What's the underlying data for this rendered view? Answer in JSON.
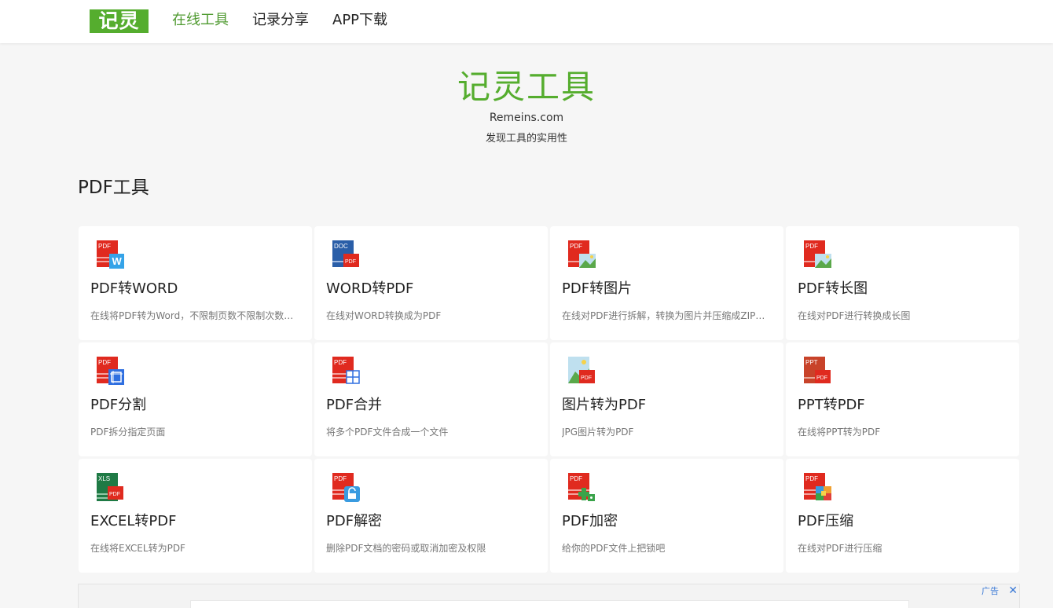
{
  "header": {
    "logo_text": "记灵",
    "nav": [
      {
        "label": "在线工具",
        "active": true
      },
      {
        "label": "记录分享",
        "active": false
      },
      {
        "label": "APP下载",
        "active": false
      }
    ]
  },
  "hero": {
    "title": "记灵工具",
    "domain": "Remeins.com",
    "slogan": "发现工具的实用性"
  },
  "section": {
    "title": "PDF工具"
  },
  "tools": [
    {
      "name": "PDF转WORD",
      "desc": "在线将PDF转为Word，不限制页数不限制次数，快速转换",
      "icon": "pdf-to-word-icon"
    },
    {
      "name": "WORD转PDF",
      "desc": "在线对WORD转换成为PDF",
      "icon": "word-to-pdf-icon"
    },
    {
      "name": "PDF转图片",
      "desc": "在线对PDF进行拆解，转换为图片并压缩成ZIP保存",
      "icon": "pdf-to-image-icon"
    },
    {
      "name": "PDF转长图",
      "desc": "在线对PDF进行转换成长图",
      "icon": "pdf-to-long-image-icon"
    },
    {
      "name": "PDF分割",
      "desc": "PDF拆分指定页面",
      "icon": "pdf-split-icon"
    },
    {
      "name": "PDF合并",
      "desc": "将多个PDF文件合成一个文件",
      "icon": "pdf-merge-icon"
    },
    {
      "name": "图片转为PDF",
      "desc": "JPG图片转为PDF",
      "icon": "image-to-pdf-icon"
    },
    {
      "name": "PPT转PDF",
      "desc": "在线将PPT转为PDF",
      "icon": "ppt-to-pdf-icon"
    },
    {
      "name": "EXCEL转PDF",
      "desc": "在线将EXCEL转为PDF",
      "icon": "excel-to-pdf-icon"
    },
    {
      "name": "PDF解密",
      "desc": "删除PDF文档的密码或取消加密及权限",
      "icon": "pdf-unlock-icon"
    },
    {
      "name": "PDF加密",
      "desc": "给你的PDF文件上把锁吧",
      "icon": "pdf-encrypt-icon"
    },
    {
      "name": "PDF压缩",
      "desc": "在线对PDF进行压缩",
      "icon": "pdf-compress-icon"
    }
  ],
  "icon_labels": {
    "pdf": "PDF",
    "doc": "DOC",
    "ppt": "PPT",
    "xls": "XLS",
    "w": "W"
  },
  "ad": {
    "label": "广告",
    "close": "✕"
  },
  "colors": {
    "brand_green": "#55ad2e",
    "pdf_red": "#e02a1f",
    "word_blue": "#2a5ea8",
    "ppt_orange": "#c8432a",
    "excel_green": "#1f7a45",
    "ad_link": "#3a79d6"
  }
}
